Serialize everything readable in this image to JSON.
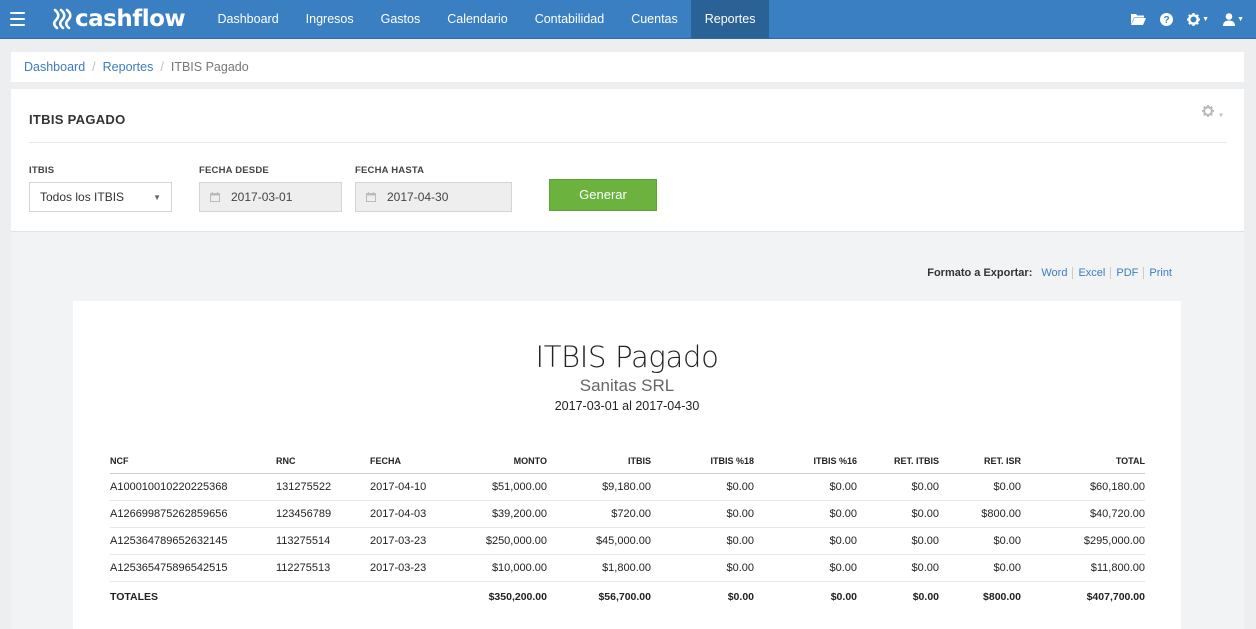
{
  "app": {
    "logo_text": "cashflow"
  },
  "nav": {
    "items": [
      {
        "label": "Dashboard"
      },
      {
        "label": "Ingresos"
      },
      {
        "label": "Gastos"
      },
      {
        "label": "Calendario"
      },
      {
        "label": "Contabilidad"
      },
      {
        "label": "Cuentas"
      },
      {
        "label": "Reportes",
        "active": true
      }
    ],
    "right_icons": [
      "folder-icon",
      "help-icon",
      "gear-icon",
      "user-icon"
    ]
  },
  "breadcrumb": [
    {
      "label": "Dashboard"
    },
    {
      "label": "Reportes"
    },
    {
      "label": "ITBIS Pagado"
    }
  ],
  "panel": {
    "title": "ITBIS PAGADO",
    "filters": {
      "itbis_label": "ITBIS",
      "itbis_value": "Todos los ITBIS",
      "fecha_desde_label": "FECHA DESDE",
      "fecha_desde_value": "2017-03-01",
      "fecha_hasta_label": "FECHA HASTA",
      "fecha_hasta_value": "2017-04-30",
      "generate_label": "Generar"
    }
  },
  "export": {
    "label": "Formato a Exportar:",
    "links": [
      "Word",
      "Excel",
      "PDF",
      "Print"
    ]
  },
  "report": {
    "title": "ITBIS Pagado",
    "company": "Sanitas SRL",
    "range": "2017-03-01 al 2017-04-30",
    "columns": [
      "NCF",
      "RNC",
      "FECHA",
      "MONTO",
      "ITBIS",
      "ITBIS %18",
      "ITBIS %16",
      "RET. ITBIS",
      "RET. ISR",
      "TOTAL"
    ],
    "rows": [
      [
        "A100010010220225368",
        "131275522",
        "2017-04-10",
        "$51,000.00",
        "$9,180.00",
        "$0.00",
        "$0.00",
        "$0.00",
        "$0.00",
        "$60,180.00"
      ],
      [
        "A126699875262859656",
        "123456789",
        "2017-04-03",
        "$39,200.00",
        "$720.00",
        "$0.00",
        "$0.00",
        "$0.00",
        "$800.00",
        "$40,720.00"
      ],
      [
        "A125364789652632145",
        "113275514",
        "2017-03-23",
        "$250,000.00",
        "$45,000.00",
        "$0.00",
        "$0.00",
        "$0.00",
        "$0.00",
        "$295,000.00"
      ],
      [
        "A125365475896542515",
        "112275513",
        "2017-03-23",
        "$10,000.00",
        "$1,800.00",
        "$0.00",
        "$0.00",
        "$0.00",
        "$0.00",
        "$11,800.00"
      ]
    ],
    "totals": [
      "TOTALES",
      "",
      "",
      "$350,200.00",
      "$56,700.00",
      "$0.00",
      "$0.00",
      "$0.00",
      "$800.00",
      "$407,700.00"
    ]
  }
}
